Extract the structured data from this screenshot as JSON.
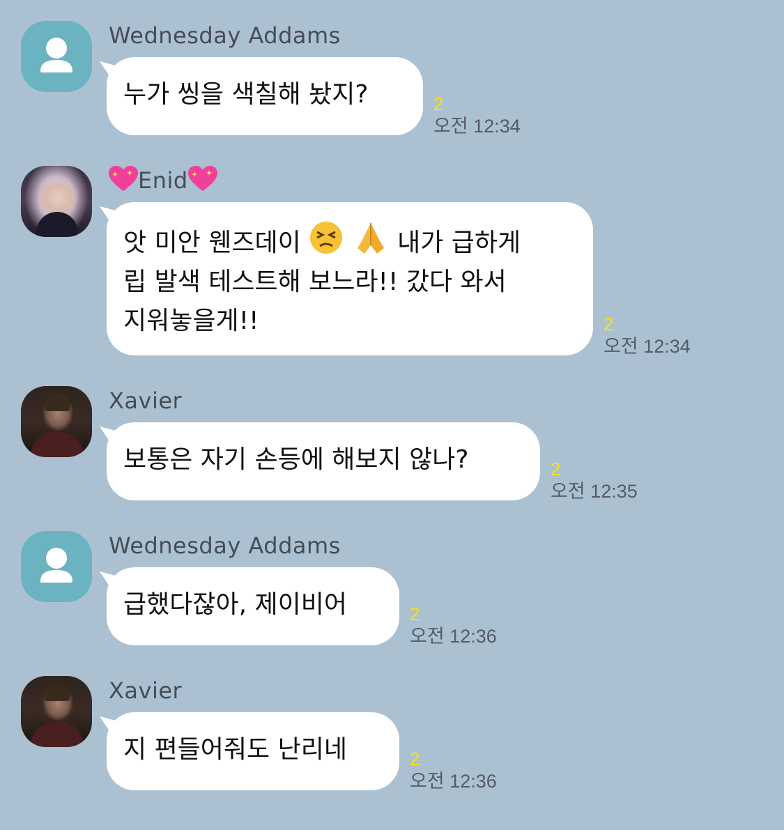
{
  "theme": {
    "background": "#abc1d1",
    "bubble": "#ffffff",
    "unread_color": "#ffe300"
  },
  "messages": [
    {
      "sender": "Wednesday Addams",
      "avatar": "default-person-icon",
      "lines": [
        "누가 씽을 색칠해 놨지?"
      ],
      "unread": "2",
      "time": "오전 12:34"
    },
    {
      "sender": "Enid",
      "sender_emoji": "sparkling-heart-icon",
      "avatar": "photo",
      "lines": [
        "앗 미안 웬즈데이",
        "내가 급하게",
        "립 발색 테스트해 보느라!! 갔다 와서",
        "지워놓을게!!"
      ],
      "emojis": [
        "persevering-face-icon",
        "folded-hands-icon"
      ],
      "unread": "2",
      "time": "오전 12:34"
    },
    {
      "sender": "Xavier",
      "avatar": "photo",
      "lines": [
        "보통은 자기 손등에 해보지 않나?"
      ],
      "unread": "2",
      "time": "오전 12:35"
    },
    {
      "sender": "Wednesday Addams",
      "avatar": "default-person-icon",
      "lines": [
        "급했다잖아, 제이비어"
      ],
      "unread": "2",
      "time": "오전 12:36"
    },
    {
      "sender": "Xavier",
      "avatar": "photo",
      "lines": [
        "지 편들어줘도 난리네"
      ],
      "unread": "2",
      "time": "오전 12:36"
    }
  ]
}
